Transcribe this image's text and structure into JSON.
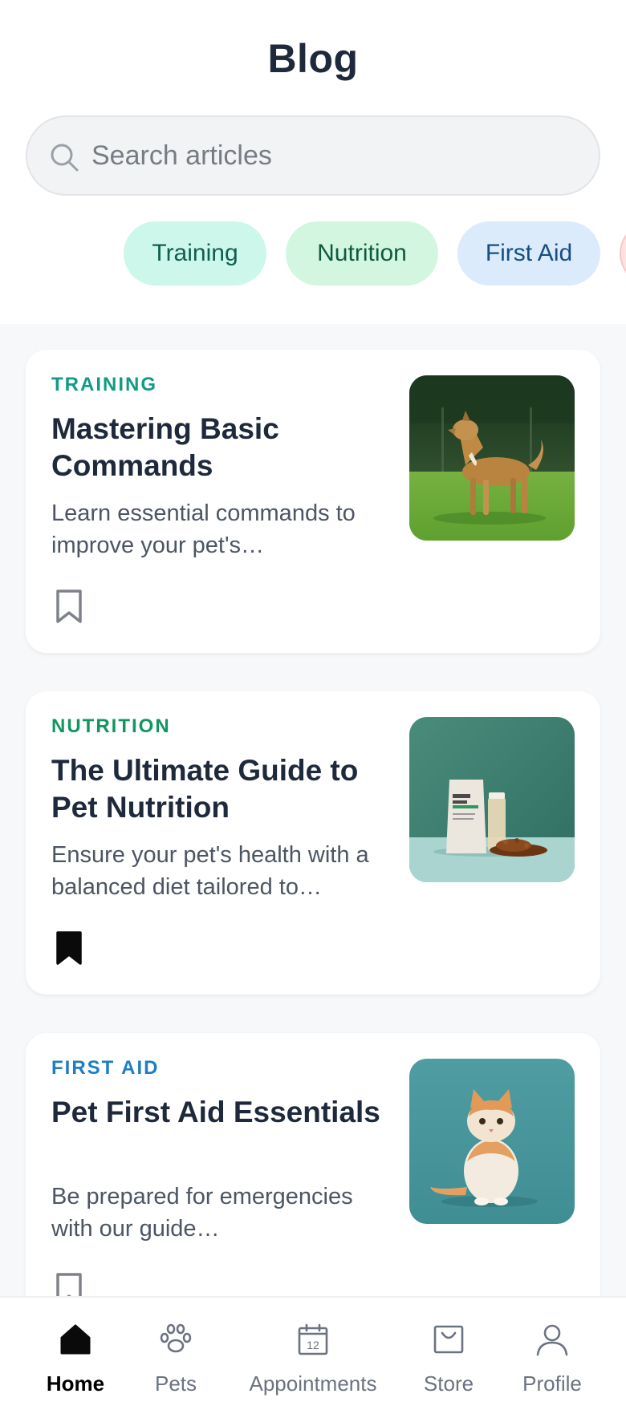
{
  "header": {
    "title": "Blog"
  },
  "search": {
    "placeholder": "Search articles",
    "value": ""
  },
  "categories": [
    {
      "label": "Training",
      "color": "#0f5e52",
      "bg": "#cdf7ea"
    },
    {
      "label": "Nutrition",
      "color": "#0e5a3c",
      "bg": "#d3f6e1"
    },
    {
      "label": "First Aid",
      "color": "#164e82",
      "bg": "#dcebfc"
    }
  ],
  "articles": [
    {
      "category": "TRAINING",
      "category_color": "#0f9b86",
      "title": "Mastering Basic Commands",
      "excerpt": "Learn essential commands to improve your pet's…",
      "bookmarked": false,
      "image": "dog-on-grass-photo"
    },
    {
      "category": "NUTRITION",
      "category_color": "#12965f",
      "title": "The Ultimate Guide to Pet Nutrition",
      "excerpt": "Ensure your pet's health with a balanced diet tailored to…",
      "bookmarked": true,
      "image": "pet-food-bag-photo"
    },
    {
      "category": "FIRST AID",
      "category_color": "#1d7ec5",
      "title": "Pet First Aid Essentials",
      "excerpt": "Be prepared for emergencies with our guide…",
      "bookmarked": false,
      "image": "cat-sitting-photo"
    }
  ],
  "nav": {
    "items": [
      {
        "label": "Home",
        "icon": "home-icon",
        "active": true
      },
      {
        "label": "Pets",
        "icon": "paw-icon",
        "active": false
      },
      {
        "label": "Appointments",
        "icon": "calendar-icon",
        "active": false,
        "icon_text": "12"
      },
      {
        "label": "Store",
        "icon": "shopping-bag-icon",
        "active": false
      },
      {
        "label": "Profile",
        "icon": "user-icon",
        "active": false
      }
    ]
  }
}
